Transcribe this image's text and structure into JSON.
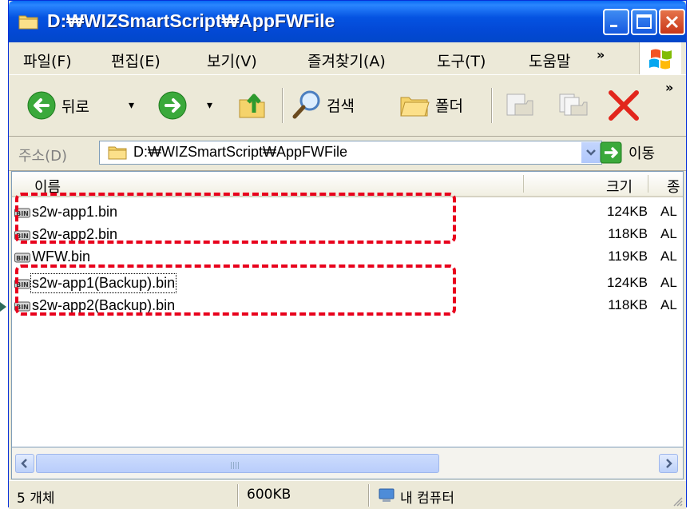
{
  "window": {
    "title": "D:₩WIZSmartScript₩AppFWFile",
    "accent_color": "#0553E1",
    "close_color": "#C8371A"
  },
  "menu": {
    "items": [
      "파일(F)",
      "편집(E)",
      "보기(V)",
      "즐겨찾기(A)",
      "도구(T)",
      "도움말"
    ],
    "overflow": "»"
  },
  "toolbar": {
    "back_label": "뒤로",
    "search_label": "검색",
    "folders_label": "폴더",
    "overflow": "»"
  },
  "address": {
    "label": "주소(D)",
    "value": "D:₩WIZSmartScript₩AppFWFile",
    "go_label": "이동"
  },
  "list": {
    "columns": {
      "name": "이름",
      "size": "크기",
      "type": "종"
    },
    "files": [
      {
        "name": "s2w-app1.bin",
        "size": "124KB",
        "type": "AL"
      },
      {
        "name": "s2w-app2.bin",
        "size": "118KB",
        "type": "AL"
      },
      {
        "name": "WFW.bin",
        "size": "119KB",
        "type": "AL"
      },
      {
        "name": "s2w-app1(Backup).bin",
        "size": "124KB",
        "type": "AL"
      },
      {
        "name": "s2w-app2(Backup).bin",
        "size": "118KB",
        "type": "AL"
      }
    ],
    "highlight_color": "#E8001C"
  },
  "status": {
    "count": "5 개체",
    "size": "600KB",
    "location": "내 컴퓨터"
  }
}
